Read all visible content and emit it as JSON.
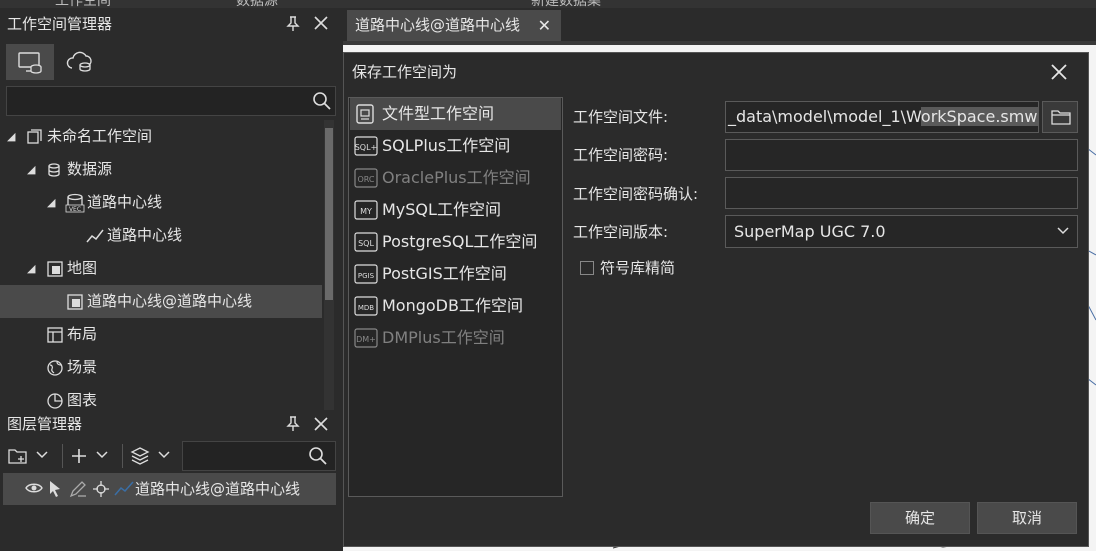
{
  "top_strip": {
    "labels": [
      "工作空间",
      "数据源",
      "新建数据集"
    ]
  },
  "workspace_panel": {
    "title": "工作空间管理器",
    "tree": [
      {
        "label": "未命名工作空间",
        "expanded": true
      },
      {
        "label": "数据源",
        "expanded": true
      },
      {
        "label": "道路中心线",
        "expanded": true
      },
      {
        "label": "道路中心线"
      },
      {
        "label": "地图",
        "expanded": true
      },
      {
        "label": "道路中心线@道路中心线",
        "selected": true
      },
      {
        "label": "布局"
      },
      {
        "label": "场景"
      },
      {
        "label": "图表"
      }
    ]
  },
  "layer_panel": {
    "title": "图层管理器",
    "layer": "道路中心线@道路中心线"
  },
  "document_tab": {
    "label": "道路中心线@道路中心线"
  },
  "dialog": {
    "title": "保存工作空间为",
    "types": [
      {
        "label": "文件型工作空间",
        "icon": "file-workspace-icon",
        "badge": "",
        "selected": true
      },
      {
        "label": "SQLPlus工作空间",
        "icon": "sqlplus-icon",
        "badge": "SQL+"
      },
      {
        "label": "OraclePlus工作空间",
        "icon": "oracle-icon",
        "badge": "ORC",
        "disabled": true
      },
      {
        "label": "MySQL工作空间",
        "icon": "mysql-icon",
        "badge": "MY"
      },
      {
        "label": "PostgreSQL工作空间",
        "icon": "postgresql-icon",
        "badge": "SQL"
      },
      {
        "label": "PostGIS工作空间",
        "icon": "postgis-icon",
        "badge": "PGIS"
      },
      {
        "label": "MongoDB工作空间",
        "icon": "mongodb-icon",
        "badge": "MDB"
      },
      {
        "label": "DMPlus工作空间",
        "icon": "dmplus-icon",
        "badge": "DM+",
        "disabled": true
      }
    ],
    "fields": {
      "file_label": "工作空间文件:",
      "file_value_prefix": "_data\\model\\model_1\\W",
      "file_value_selected": "orkSpace.smwu",
      "password_label": "工作空间密码:",
      "password_value": "",
      "confirm_label": "工作空间密码确认:",
      "confirm_value": "",
      "version_label": "工作空间版本:",
      "version_value": "SuperMap UGC 7.0",
      "simplify_label": "符号库精简",
      "simplify_checked": false
    },
    "ok": "确定",
    "cancel": "取消"
  },
  "colors": {
    "panel_bg": "#2b2b2b",
    "selected_bg": "#4a4a4a",
    "input_bg": "#262626",
    "map_bg": "#f4f4f4"
  }
}
